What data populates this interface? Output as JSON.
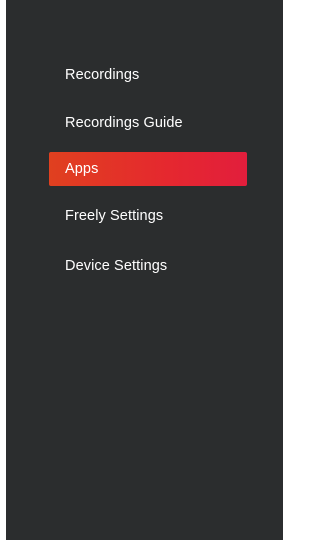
{
  "menu": {
    "items": [
      {
        "label": "Recordings",
        "selected": false
      },
      {
        "label": "Recordings Guide",
        "selected": false
      },
      {
        "label": "Apps",
        "selected": true
      },
      {
        "label": "Freely Settings",
        "selected": false
      },
      {
        "label": "Device Settings",
        "selected": false
      }
    ]
  },
  "colors": {
    "panel_background": "#2b2d2e",
    "selected_highlight": "#e5282f",
    "text": "#ffffff"
  }
}
